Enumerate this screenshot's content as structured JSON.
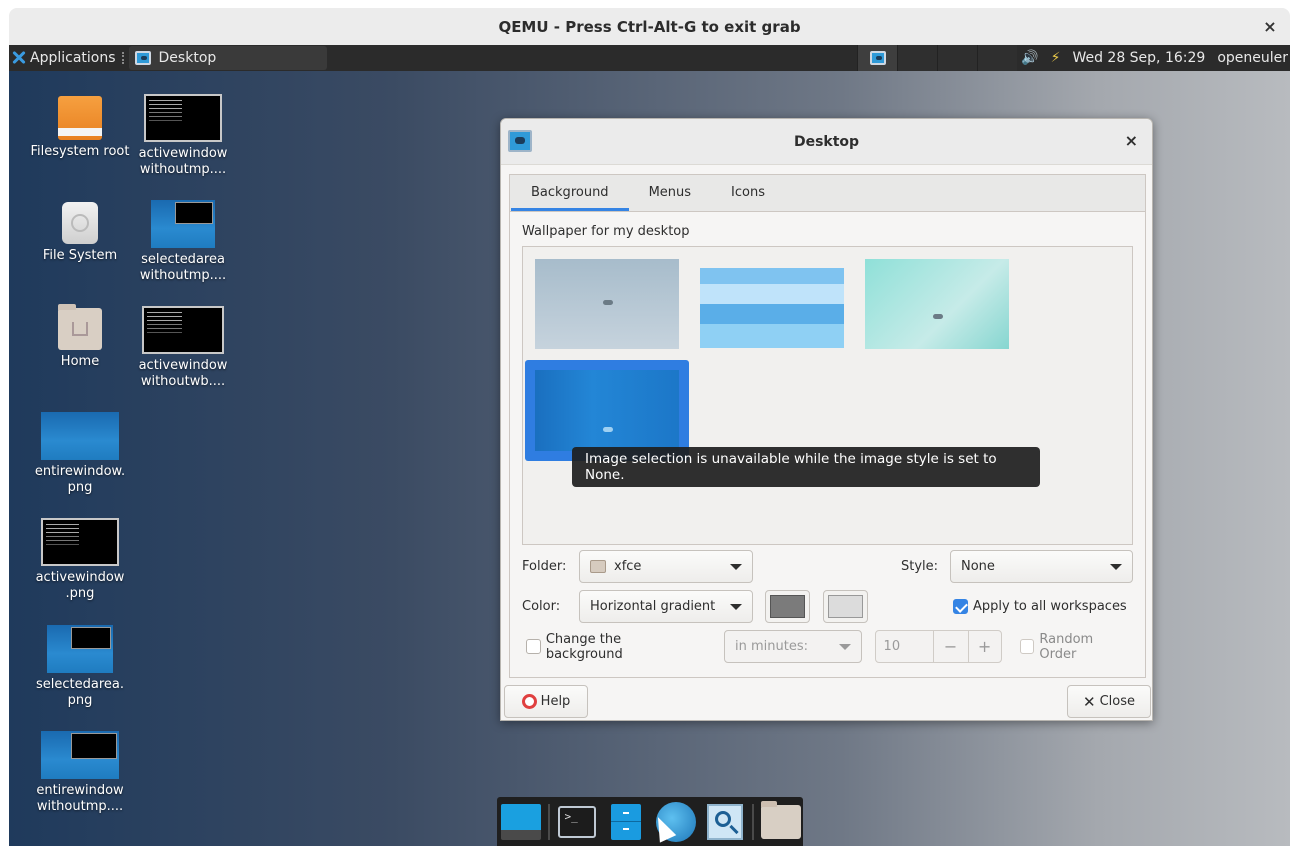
{
  "qemu": {
    "title": "QEMU - Press Ctrl-Alt-G to exit grab",
    "close_glyph": "×"
  },
  "panel": {
    "applications_label": "Applications",
    "task_label": "Desktop",
    "clock": "Wed 28 Sep, 16:29",
    "user": "openeuler",
    "volume_icon": "🔊",
    "power_icon": "⚡"
  },
  "desktop_icons": {
    "filesystem_root": "Filesystem root",
    "file_system": "File System",
    "home": "Home",
    "entirewindow_png": "entirewindow.\npng",
    "activewindow_png": "activewindow\n.png",
    "selectedarea_png": "selectedarea.\npng",
    "entirewindow_withoutmp": "entirewindow\nwithoutmp....",
    "activewindow_withoutmp": "activewindow\nwithoutmp....",
    "selectedarea_withoutmp": "selectedarea\nwithoutmp....",
    "activewindow_withoutwb": "activewindow\nwithoutwb...."
  },
  "dialog": {
    "title": "Desktop",
    "close_glyph": "×",
    "tabs": [
      "Background",
      "Menus",
      "Icons"
    ],
    "wallpaper_label": "Wallpaper for my desktop",
    "tooltip": "Image selection is unavailable while the image style is set to None.",
    "folder_label": "Folder:",
    "folder_value": "xfce",
    "style_label": "Style:",
    "style_value": "None",
    "color_label": "Color:",
    "color_value": "Horizontal gradient",
    "color1": "#7b7b7b",
    "color2": "#dcdcdc",
    "apply_all_label": "Apply to all workspaces",
    "change_bg_label": "Change the background",
    "interval_value": "in minutes:",
    "interval_number": "10",
    "random_order_label": "Random Order",
    "help_label": "Help",
    "close_label": "Close"
  },
  "colors": {
    "accent": "#3584e4",
    "selection": "#2f7de1"
  }
}
